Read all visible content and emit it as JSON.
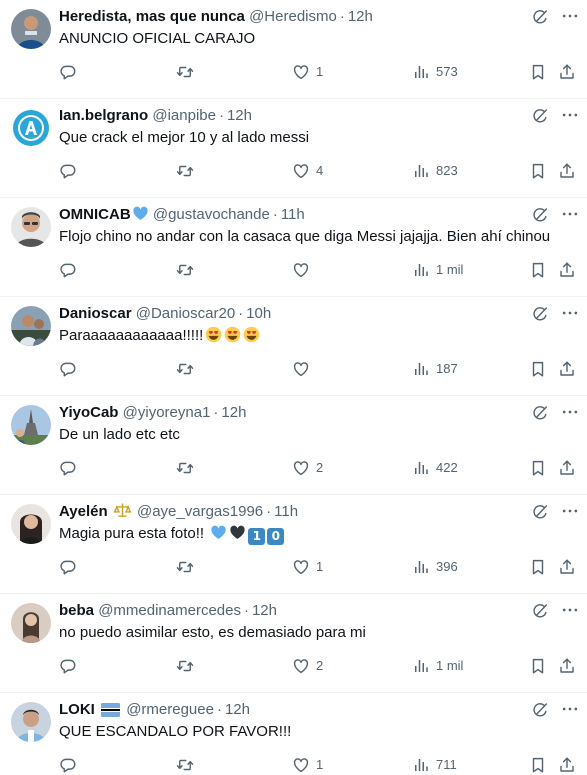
{
  "tweets": [
    {
      "display_name": "Heredista, mas que nunca",
      "handle": "@Heredismo",
      "time": "12h",
      "text": "ANUNCIO OFICIAL CARAJO",
      "replies": "",
      "retweets": "",
      "likes": "1",
      "views": "573"
    },
    {
      "display_name": "Ian.belgrano",
      "handle": "@ianpibe",
      "time": "12h",
      "text": "Que crack el mejor 10 y al lado messi",
      "replies": "",
      "retweets": "",
      "likes": "4",
      "views": "823"
    },
    {
      "display_name": "OMNICAB",
      "handle": "@gustavochande",
      "time": "11h",
      "text": "Flojo chino no andar con la casaca que diga Messi jajajja. Bien ahí chinou",
      "replies": "",
      "retweets": "",
      "likes": "",
      "views": "1 mil"
    },
    {
      "display_name": "Danioscar",
      "handle": "@Danioscar20",
      "time": "10h",
      "text": "Paraaaaaaaaaaaa!!!!!",
      "replies": "",
      "retweets": "",
      "likes": "",
      "views": "187"
    },
    {
      "display_name": "YiyoCab",
      "handle": "@yiyoreyna1",
      "time": "12h",
      "text": "De un lado etc etc",
      "replies": "",
      "retweets": "",
      "likes": "2",
      "views": "422"
    },
    {
      "display_name": "Ayelén",
      "handle": "@aye_vargas1996",
      "time": "11h",
      "text": "Magia pura esta foto!!",
      "key_digits": [
        "1",
        "0"
      ],
      "replies": "",
      "retweets": "",
      "likes": "1",
      "views": "396"
    },
    {
      "display_name": "beba",
      "handle": "@mmedinamercedes",
      "time": "12h",
      "text": "no puedo asimilar esto, es demasiado para mi",
      "replies": "",
      "retweets": "",
      "likes": "2",
      "views": "1 mil"
    },
    {
      "display_name": "LOKI",
      "handle": "@rmereguee",
      "time": "12h",
      "text": "QUE ESCANDALO POR FAVOR!!!",
      "replies": "",
      "retweets": "",
      "likes": "1",
      "views": "711"
    }
  ],
  "separator": "·",
  "colors": {
    "text_primary": "#0f1419",
    "text_secondary": "#536471",
    "divider": "#eff3f4",
    "verified_heart": "#5dadec"
  },
  "icons": [
    "grok-icon",
    "more-icon",
    "reply-icon",
    "retweet-icon",
    "like-icon",
    "views-icon",
    "bookmark-icon",
    "share-icon"
  ]
}
